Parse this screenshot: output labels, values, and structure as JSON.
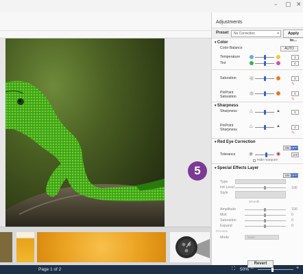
{
  "window": {
    "minimize": "–",
    "maximize": "▢",
    "close": "✕"
  },
  "statusbar": {
    "page_text": "Page 1 of 2",
    "zoom": "50%"
  },
  "badge": "5",
  "panel": {
    "title": "Adjustments",
    "preset_label": "Preset",
    "preset_value": "No Correction",
    "apply_label": "Apply to...",
    "color": {
      "title": "Color",
      "color_balance": "Color Balance",
      "auto": "AUTO",
      "temperature": "Temperature",
      "temperature_value": "0",
      "tint": "Tint",
      "tint_value": "0",
      "saturation": "Saturation",
      "saturation_value": "0",
      "pinpoint_saturation_line1": "PinPoint",
      "pinpoint_saturation_line2": "Saturation",
      "pinpoint_saturation_value": "0"
    },
    "sharpness": {
      "title": "Sharpness",
      "sharpness": "Sharpness",
      "sharpness_value": "0",
      "pinpoint_line1": "PinPoint",
      "pinpoint_line2": "Sharpness",
      "pinpoint_value": "0"
    },
    "red_eye": {
      "title": "Red Eye Correction",
      "on": "ON",
      "off": "OFF",
      "tolerance": "Tolerance",
      "tolerance_value": "100",
      "hide_marquee": "Hide marquee"
    },
    "special": {
      "title": "Special Effects Layer",
      "on": "ON",
      "off": "OFF",
      "type": "Type",
      "ink_level": "Ink Level",
      "ink_value": "100",
      "style": "Style",
      "style_value": "Smooth",
      "amplitude": "Amplitude",
      "amplitude_value": "100",
      "mist": "Mist",
      "mist_value": "0",
      "saturation": "Saturation",
      "saturation_value": "0",
      "expand": "Expand",
      "expand_value": "0",
      "preview": "Preview",
      "mode": "Mode",
      "mode_value": "None"
    },
    "revert_label": "Revert"
  },
  "colors": {
    "accent_blue": "#2f62d6",
    "badge_purple": "#7b3a93",
    "status_bar": "#1e3048",
    "lizard_green": "#3fa21a"
  }
}
